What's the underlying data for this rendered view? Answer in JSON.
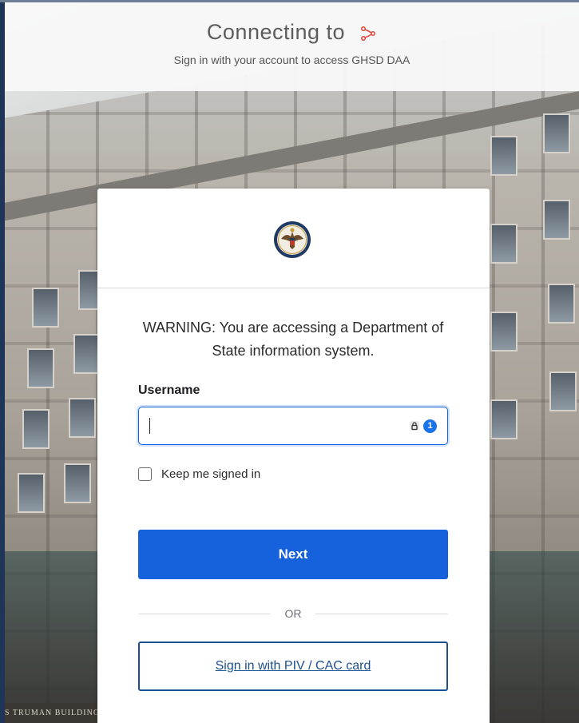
{
  "header": {
    "title": "Connecting to",
    "app_icon": "okta-app-connector-icon",
    "subtitle": "Sign in with your account to access GHSD DAA"
  },
  "background": {
    "building_sign": "S TRUMAN BUILDING"
  },
  "card": {
    "logo": "department-of-state-seal",
    "warning": "WARNING: You are accessing a Department of State information system.",
    "username_label": "Username",
    "username_value": "",
    "password_manager_icons": [
      "lock-icon",
      "1password-icon"
    ],
    "keep_signed_in_label": "Keep me signed in",
    "keep_signed_in_checked": false,
    "next_label": "Next",
    "or_label": "OR",
    "piv_label": "Sign in with PIV / CAC card"
  },
  "colors": {
    "primary": "#1662dd",
    "piv_border": "#1c4f8f",
    "header_bg": "#f8f8f8"
  }
}
